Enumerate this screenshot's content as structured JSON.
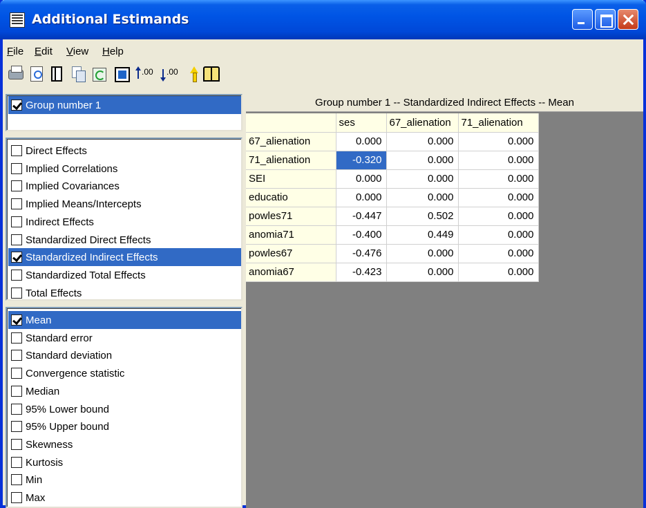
{
  "window": {
    "title": "Additional Estimands"
  },
  "menu": {
    "items": [
      {
        "label": "File",
        "underline": "F",
        "rest": "ile"
      },
      {
        "label": "Edit",
        "underline": "E",
        "rest": "dit"
      },
      {
        "label": "View",
        "underline": "V",
        "rest": "iew"
      },
      {
        "label": "Help",
        "underline": "H",
        "rest": "elp"
      }
    ]
  },
  "toolbar": {
    "icons": [
      "print-icon",
      "print-preview-icon",
      "page-setup-icon",
      "copy-icon",
      "refresh-icon",
      "fit-window-icon",
      "increase-decimals-icon",
      "decrease-decimals-icon",
      "pointer-icon",
      "help-book-icon"
    ],
    "increase_decimals_label": ".00",
    "decrease_decimals_label": ".00"
  },
  "groups": {
    "items": [
      {
        "label": "Group number 1",
        "checked": true
      }
    ]
  },
  "effects": {
    "items": [
      {
        "label": "Direct Effects",
        "checked": false
      },
      {
        "label": "Implied Correlations",
        "checked": false
      },
      {
        "label": "Implied Covariances",
        "checked": false
      },
      {
        "label": "Implied Means/Intercepts",
        "checked": false
      },
      {
        "label": "Indirect Effects",
        "checked": false
      },
      {
        "label": "Standardized Direct Effects",
        "checked": false
      },
      {
        "label": "Standardized Indirect Effects",
        "checked": true
      },
      {
        "label": "Standardized Total Effects",
        "checked": false
      },
      {
        "label": "Total Effects",
        "checked": false
      }
    ]
  },
  "stats": {
    "items": [
      {
        "label": "Mean",
        "checked": true
      },
      {
        "label": "Standard error",
        "checked": false
      },
      {
        "label": "Standard deviation",
        "checked": false
      },
      {
        "label": "Convergence statistic",
        "checked": false
      },
      {
        "label": "Median",
        "checked": false
      },
      {
        "label": "95% Lower bound",
        "checked": false
      },
      {
        "label": "95% Upper bound",
        "checked": false
      },
      {
        "label": "Skewness",
        "checked": false
      },
      {
        "label": "Kurtosis",
        "checked": false
      },
      {
        "label": "Min",
        "checked": false
      },
      {
        "label": "Max",
        "checked": false
      }
    ]
  },
  "grid": {
    "title": "Group number 1 -- Standardized Indirect Effects -- Mean",
    "columns": [
      "ses",
      "67_alienation",
      "71_alienation"
    ],
    "rows": [
      {
        "label": "67_alienation",
        "values": [
          "0.000",
          "0.000",
          "0.000"
        ]
      },
      {
        "label": "71_alienation",
        "values": [
          "-0.320",
          "0.000",
          "0.000"
        ]
      },
      {
        "label": "SEI",
        "values": [
          "0.000",
          "0.000",
          "0.000"
        ]
      },
      {
        "label": "educatio",
        "values": [
          "0.000",
          "0.000",
          "0.000"
        ]
      },
      {
        "label": "powles71",
        "values": [
          "-0.447",
          "0.502",
          "0.000"
        ]
      },
      {
        "label": "anomia71",
        "values": [
          "-0.400",
          "0.449",
          "0.000"
        ]
      },
      {
        "label": "powles67",
        "values": [
          "-0.476",
          "0.000",
          "0.000"
        ]
      },
      {
        "label": "anomia67",
        "values": [
          "-0.423",
          "0.000",
          "0.000"
        ]
      }
    ],
    "selected_cell": {
      "row": 1,
      "col": 0
    }
  }
}
